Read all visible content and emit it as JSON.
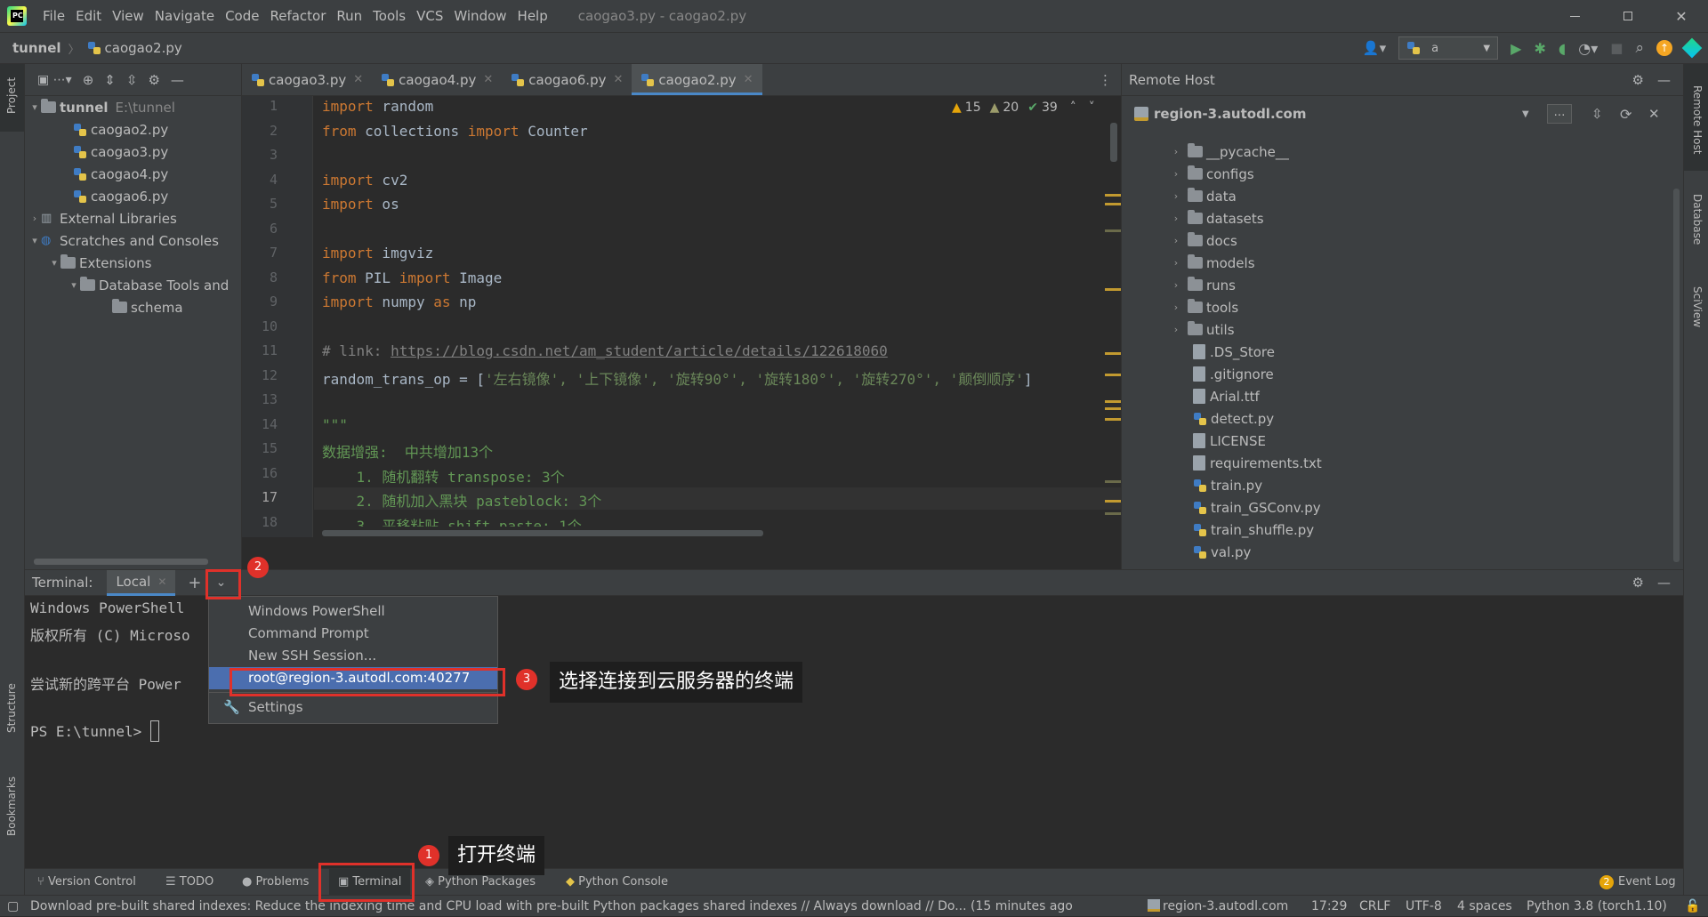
{
  "window": {
    "title": "caogao3.py - caogao2.py"
  },
  "menu": [
    "File",
    "Edit",
    "View",
    "Navigate",
    "Code",
    "Refactor",
    "Run",
    "Tools",
    "VCS",
    "Window",
    "Help"
  ],
  "breadcrumb": {
    "project": "tunnel",
    "file": "caogao2.py"
  },
  "run_config": "a",
  "left_strip": {
    "project": "Project",
    "structure": "Structure",
    "bookmarks": "Bookmarks"
  },
  "right_strip": {
    "remote_host": "Remote Host",
    "database": "Database",
    "sciview": "SciView"
  },
  "project_tree": [
    {
      "label": "tunnel",
      "path": "E:\\tunnel",
      "type": "root"
    },
    {
      "label": "caogao2.py",
      "type": "py"
    },
    {
      "label": "caogao3.py",
      "type": "py"
    },
    {
      "label": "caogao4.py",
      "type": "py"
    },
    {
      "label": "caogao6.py",
      "type": "py"
    },
    {
      "label": "External Libraries",
      "type": "lib"
    },
    {
      "label": "Scratches and Consoles",
      "type": "scratch"
    },
    {
      "label": "Extensions",
      "type": "folder"
    },
    {
      "label": "Database Tools and",
      "type": "folder"
    },
    {
      "label": "schema",
      "type": "folder"
    }
  ],
  "tabs": [
    {
      "label": "caogao3.py",
      "active": false
    },
    {
      "label": "caogao4.py",
      "active": false
    },
    {
      "label": "caogao6.py",
      "active": false
    },
    {
      "label": "caogao2.py",
      "active": true
    }
  ],
  "inspections": {
    "warnings": "15",
    "weak_warnings": "20",
    "ok": "39"
  },
  "code_lines": [
    "1",
    "2",
    "3",
    "4",
    "5",
    "6",
    "7",
    "8",
    "9",
    "10",
    "11",
    "12",
    "13",
    "14",
    "15",
    "16",
    "17",
    "18"
  ],
  "code": {
    "l1_kw": "import",
    "l1_rest": " random",
    "l2_kw1": "from",
    "l2_mod": " collections ",
    "l2_kw2": "import",
    "l2_rest": " Counter",
    "l4_kw": "import",
    "l4_rest": " cv2",
    "l5_kw": "import",
    "l5_rest": " os",
    "l7_kw": "import",
    "l7_rest": " imgviz",
    "l8_kw1": "from",
    "l8_mod": " PIL ",
    "l8_kw2": "import",
    "l8_rest": " Image",
    "l9_kw": "import",
    "l9_mod": " numpy ",
    "l9_kw2": "as",
    "l9_rest": " np",
    "l11_cm": "# link: ",
    "l11_link": "https://blog.csdn.net/am_student/article/details/122618060",
    "l12_a": "random_trans_op = [",
    "l12_s": "'左右镜像', '上下镜像', '旋转90°', '旋转180°', '旋转270°', '颠倒顺序'",
    "l12_b": "]",
    "l14": "\"\"\"",
    "l15": "数据增强:  中共增加13个",
    "l16": "    1. 随机翻转 transpose: 3个",
    "l17": "    2. 随机加入黑块 pasteblock: 3个",
    "l18": "    3. 平移粘贴 shift_paste: 1个"
  },
  "remote": {
    "title": "Remote Host",
    "server": "region-3.autodl.com",
    "items": [
      {
        "label": "__pycache__",
        "type": "folder"
      },
      {
        "label": "configs",
        "type": "folder"
      },
      {
        "label": "data",
        "type": "folder"
      },
      {
        "label": "datasets",
        "type": "folder"
      },
      {
        "label": "docs",
        "type": "folder"
      },
      {
        "label": "models",
        "type": "folder"
      },
      {
        "label": "runs",
        "type": "folder"
      },
      {
        "label": "tools",
        "type": "folder"
      },
      {
        "label": "utils",
        "type": "folder"
      },
      {
        "label": ".DS_Store",
        "type": "file"
      },
      {
        "label": ".gitignore",
        "type": "file"
      },
      {
        "label": "Arial.ttf",
        "type": "file"
      },
      {
        "label": "detect.py",
        "type": "py"
      },
      {
        "label": "LICENSE",
        "type": "file"
      },
      {
        "label": "requirements.txt",
        "type": "file"
      },
      {
        "label": "train.py",
        "type": "py"
      },
      {
        "label": "train_GSConv.py",
        "type": "py"
      },
      {
        "label": "train_shuffle.py",
        "type": "py"
      },
      {
        "label": "val.py",
        "type": "py"
      }
    ]
  },
  "terminal": {
    "label": "Terminal:",
    "tab": "Local",
    "lines": [
      "Windows PowerShell",
      "版权所有 (C) Microso",
      "",
      "尝试新的跨平台 Power",
      "",
      "PS E:\\tunnel> "
    ]
  },
  "dropdown": {
    "items": [
      "Windows PowerShell",
      "Command Prompt",
      "New SSH Session...",
      "root@region-3.autodl.com:40277"
    ],
    "settings": "Settings"
  },
  "annotations": {
    "badge1": "1",
    "badge2": "2",
    "badge3": "3",
    "callout1": "打开终端",
    "callout3": "选择连接到云服务器的终端"
  },
  "bottom_tools": [
    "Version Control",
    "TODO",
    "Problems",
    "Terminal",
    "Python Packages",
    "Python Console"
  ],
  "event_log": {
    "count": "2",
    "label": "Event Log"
  },
  "status": {
    "message": "Download pre-built shared indexes: Reduce the indexing time and CPU load with pre-built Python packages shared indexes // Always download // Do... (15 minutes ago",
    "host": "region-3.autodl.com",
    "position": "17:29",
    "line_sep": "CRLF",
    "encoding": "UTF-8",
    "indent": "4 spaces",
    "interpreter": "Python 3.8 (torch1.10)"
  }
}
